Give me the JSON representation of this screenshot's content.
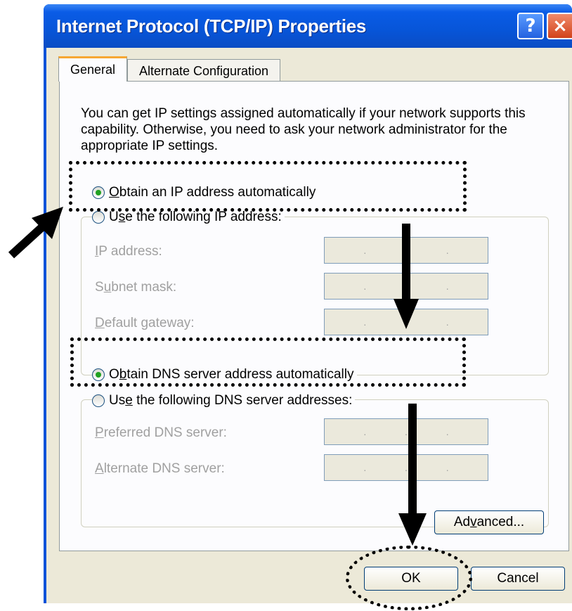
{
  "window": {
    "title": "Internet Protocol (TCP/IP) Properties",
    "help_glyph": "?",
    "close_glyph": "×"
  },
  "tabs": [
    {
      "label": "General",
      "selected": true
    },
    {
      "label": "Alternate Configuration",
      "selected": false
    }
  ],
  "description": "You can get IP settings assigned automatically if your network supports this capability. Otherwise, you need to ask your network administrator for the appropriate IP settings.",
  "ip": {
    "auto_pre": "",
    "auto_key": "O",
    "auto_post": "btain an IP address automatically",
    "auto_selected": true,
    "manual_pre": "U",
    "manual_key": "s",
    "manual_post": "e the following IP address:",
    "fields": [
      {
        "key": "I",
        "rest": "P address:",
        "pre": ""
      },
      {
        "key": "u",
        "rest": "bnet mask:",
        "pre": "S"
      },
      {
        "key": "D",
        "rest": "efault gateway:",
        "pre": ""
      }
    ],
    "box_dots": ". . ."
  },
  "dns": {
    "auto_pre": "O",
    "auto_key": "b",
    "auto_post": "tain DNS server address automatically",
    "auto_selected": true,
    "manual_pre": "Us",
    "manual_key": "e",
    "manual_post": " the following DNS server addresses:",
    "fields": [
      {
        "key": "P",
        "rest": "referred DNS server:",
        "pre": ""
      },
      {
        "key": "A",
        "rest": "lternate DNS server:",
        "pre": ""
      }
    ]
  },
  "buttons": {
    "advanced_pre": "Ad",
    "advanced_key": "v",
    "advanced_post": "anced...",
    "ok": "OK",
    "cancel": "Cancel"
  },
  "colors": {
    "titlebar": "#0a5ce6",
    "dialog_bg": "#ece9d8",
    "tab_accent": "#f7a733",
    "radio_dot": "#21a121",
    "close_button": "#d2431c"
  },
  "icons": [
    "help-icon",
    "close-icon",
    "radio-checked",
    "radio-unchecked"
  ]
}
